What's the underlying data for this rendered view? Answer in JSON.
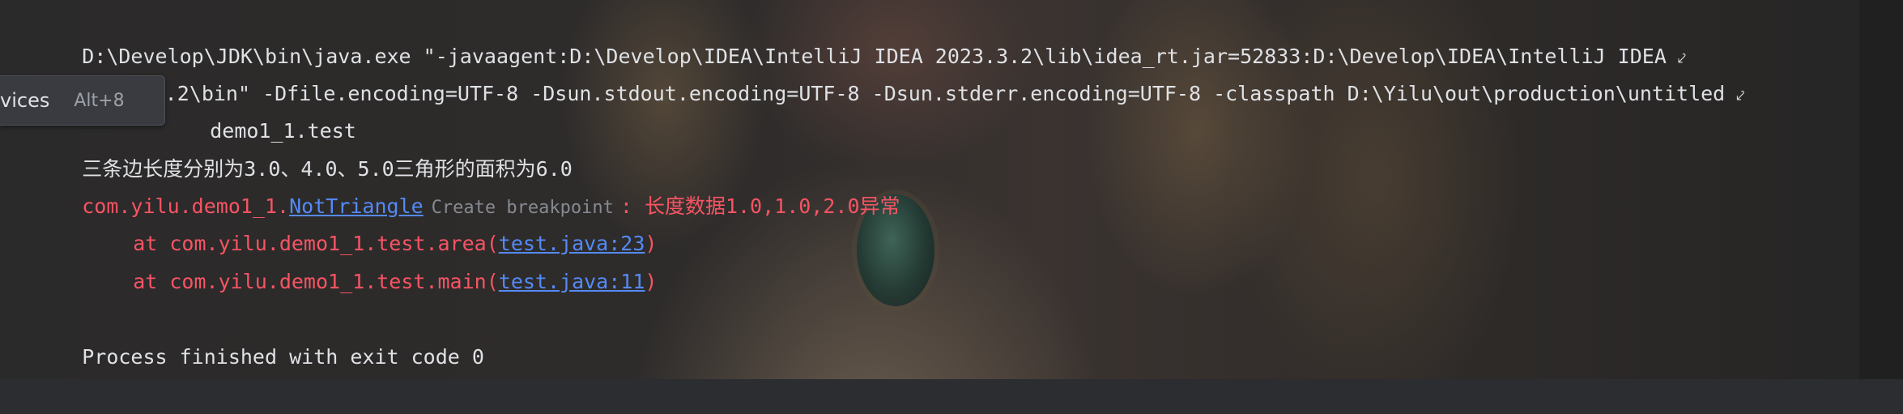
{
  "console": {
    "line1": "D:\\Develop\\JDK\\bin\\java.exe \"-javaagent:D:\\Develop\\IDEA\\IntelliJ IDEA 2023.3.2\\lib\\idea_rt.jar=52833:D:\\Develop\\IDEA\\IntelliJ IDEA",
    "line2": "2023.3.2\\bin\" -Dfile.encoding=UTF-8 -Dsun.stdout.encoding=UTF-8 -Dsun.stderr.encoding=UTF-8 -classpath D:\\Yilu\\out\\production\\untitled",
    "line3": "demo1_1.test",
    "line4": "三条边长度分别为3.0、4.0、5.0三角形的面积为6.0",
    "line5": {
      "prefix": "com.yilu.demo1_1.",
      "class_link": "NotTriangle",
      "hint": "Create breakpoint",
      "message": ": 长度数据1.0,1.0,2.0异常"
    },
    "line6": {
      "prefix": "at com.yilu.demo1_1.test.area(",
      "link": "test.java:23",
      "suffix": ")"
    },
    "line7": {
      "prefix": "at com.yilu.demo1_1.test.main(",
      "link": "test.java:11",
      "suffix": ")"
    },
    "line8": "Process finished with exit code 0"
  },
  "tooltip": {
    "label": "vices",
    "shortcut": "Alt+8"
  },
  "icons": {
    "soft_wrap": "soft-wrap-icon"
  },
  "colors": {
    "text": "#dfe1e5",
    "error": "#f75464",
    "link": "#548af7",
    "hint": "#868a91"
  }
}
